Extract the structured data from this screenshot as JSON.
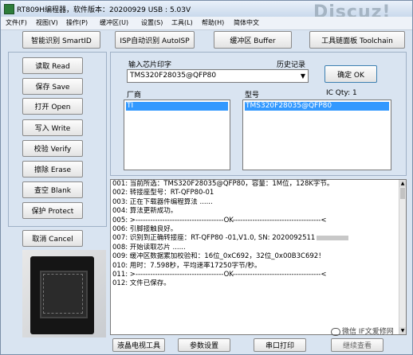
{
  "window": {
    "title": "RT809H编程器，软件版本：20200929  USB : 5.03V",
    "watermark": "Discuz!"
  },
  "menu": [
    "文件(F)",
    "视图(V)",
    "操作(P)",
    "缓冲区(U)",
    "设置(S)",
    "工具(L)",
    "帮助(H)",
    "简体中文"
  ],
  "toolbar": {
    "smart_id": "智能识别 SmartID",
    "isp_auto": "ISP自动识别 AutoISP",
    "buffer": "缓冲区 Buffer",
    "toolchain": "工具链面板 Toolchain"
  },
  "ops": {
    "read": "读取 Read",
    "save": "保存 Save",
    "open": "打开 Open",
    "write": "写入 Write",
    "verify": "校验 Verify",
    "erase": "擦除 Erase",
    "blank": "查空 Blank",
    "protect": "保护 Protect",
    "cancel": "取消 Cancel"
  },
  "chip": {
    "input_label": "输入芯片印字",
    "history_label": "历史记录",
    "value": "TMS320F28035@QFP80",
    "ok_button": "确定 OK",
    "vendor_label": "厂商",
    "model_label": "型号",
    "ic_qty": "IC Qty: 1",
    "vendor_selected": "TI",
    "model_selected": "TMS320F28035@QFP80"
  },
  "log": [
    "001: 当前所选：TMS320F28035@QFP80，容量：1M位，128K字节。",
    "002: 转接座型号：RT-QFP80-01",
    "003: 正在下载器件编程算法 ......",
    "004: 算法更新成功。",
    "005: >------------------------------------OK------------------------------------<",
    "006: 引脚接触良好。",
    "007: 识别到正确转接座：RT-QFP80 -01,V1.0, SN: 2020092511",
    "008: 开始读取芯片 ......",
    "009: 缓冲区数据累加校验和：16位_0xC692，32位_0x00B3C692！",
    "010: 用时：7.598秒，平均速率17250字节/秒。",
    "011: >------------------------------------OK------------------------------------<",
    "012: 文件已保存。"
  ],
  "bottom": {
    "lcd_tool": "液晶电视工具",
    "params": "参数设置",
    "serial_print": "串口打印",
    "view_more": "继续查看",
    "wechat": "微信 IF文爱修网"
  },
  "icons": {
    "app": "chip-icon",
    "dropdown": "chevron-down-icon"
  }
}
